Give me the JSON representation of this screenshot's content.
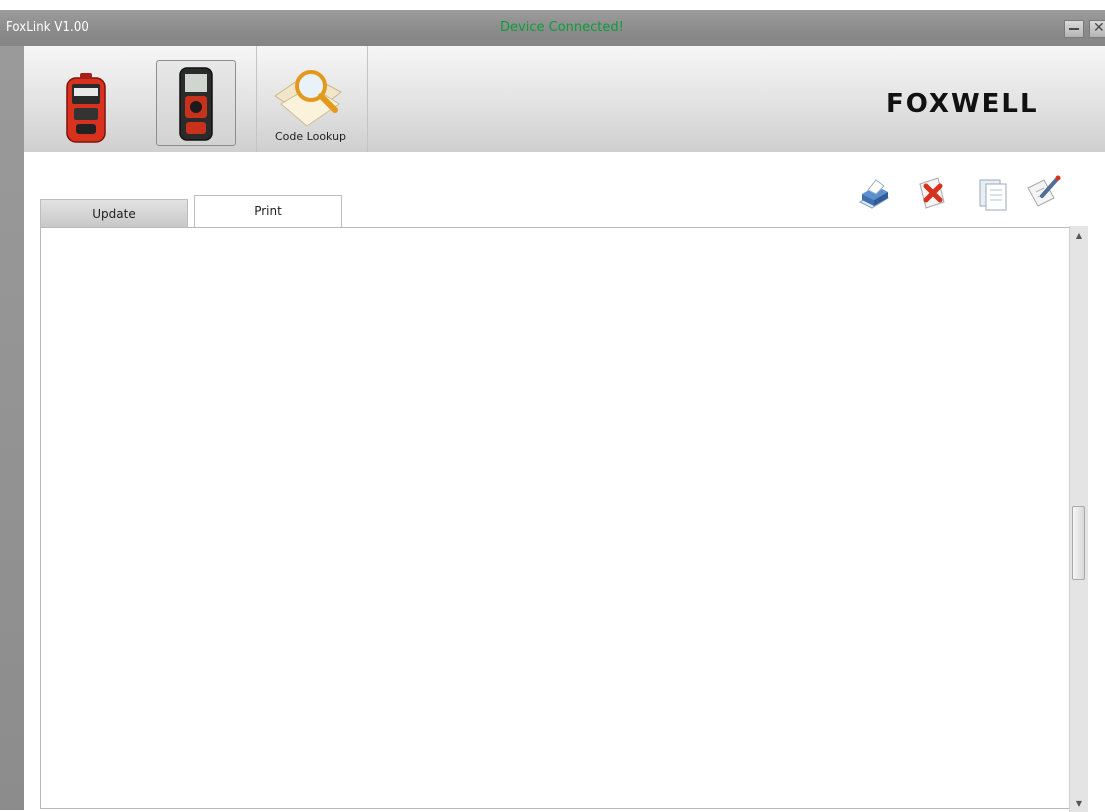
{
  "window": {
    "title": "FoxLink V1.00",
    "status": "Device Connected!",
    "status_color": "#0c9e3a"
  },
  "toolbar": {
    "buttons": [
      {
        "icon": "red-scanner-device-icon",
        "label": ""
      },
      {
        "icon": "black-scanner-device-icon",
        "label": ""
      },
      {
        "icon": "magnifier-code-lookup-icon",
        "label": "Code Lookup"
      }
    ],
    "logo": "FOXWELL"
  },
  "tabs": [
    {
      "label": "Update",
      "active": false
    },
    {
      "label": "Print",
      "active": true
    }
  ],
  "actions": [
    {
      "icon": "printer-icon"
    },
    {
      "icon": "delete-icon"
    },
    {
      "icon": "document-copy-icon"
    },
    {
      "icon": "edit-icon"
    }
  ],
  "colors": {
    "chrome": "#8f8f8f",
    "accent_red": "#d8321e"
  }
}
